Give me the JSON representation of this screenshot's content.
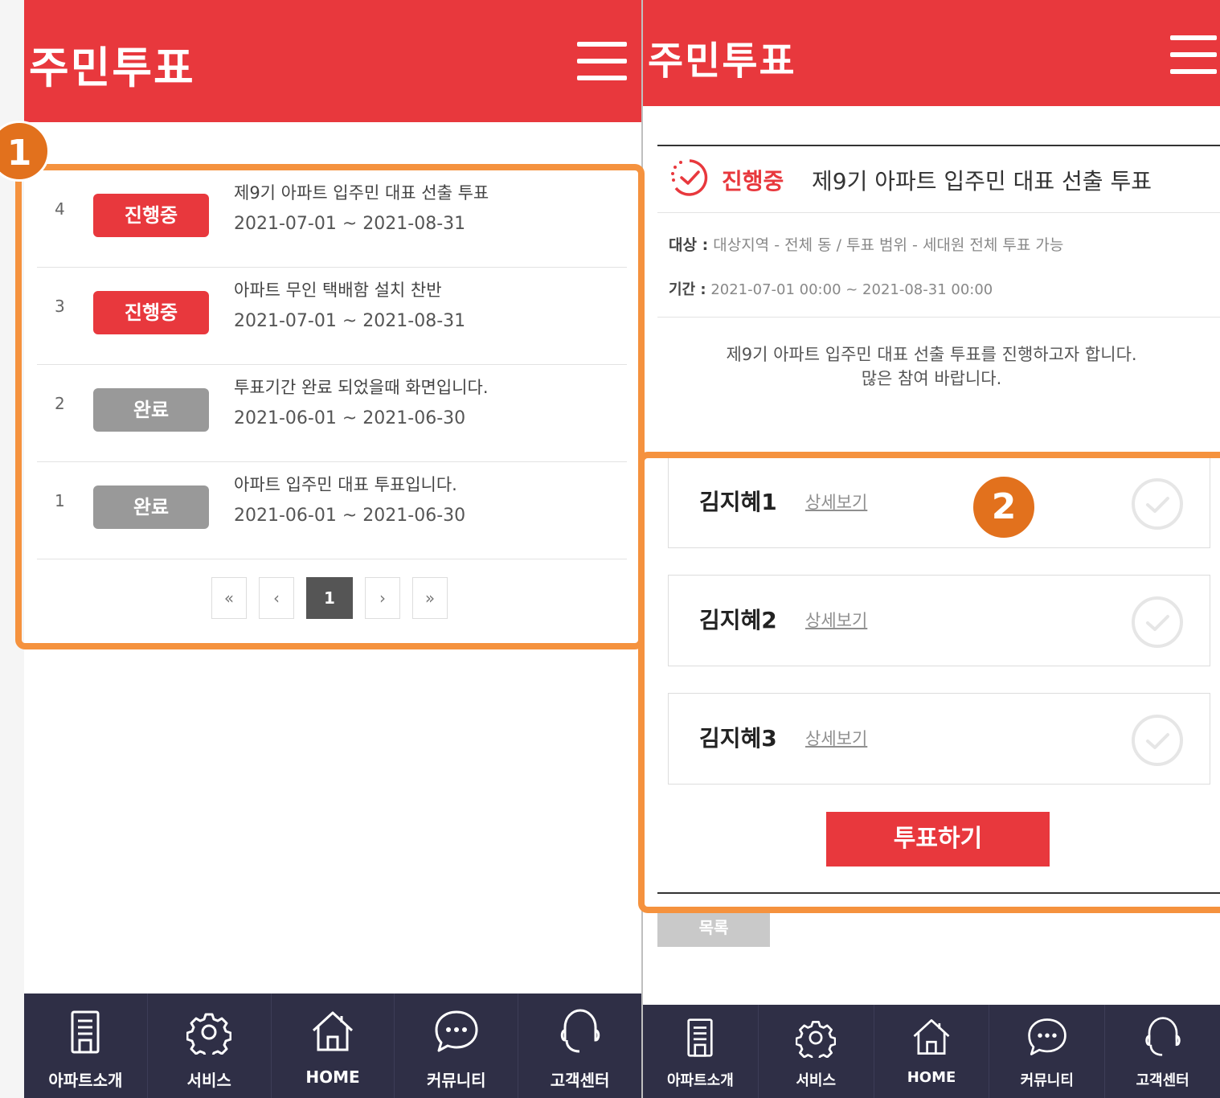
{
  "list_screen": {
    "header_title": "주민투표",
    "votes": [
      {
        "num": "4",
        "status": "진행중",
        "status_type": "active",
        "title": "제9기 아파트 입주민 대표 선출 투표",
        "period": "2021-07-01 ~ 2021-08-31"
      },
      {
        "num": "3",
        "status": "진행중",
        "status_type": "active",
        "title": "아파트 무인 택배함 설치 찬반",
        "period": "2021-07-01 ~ 2021-08-31"
      },
      {
        "num": "2",
        "status": "완료",
        "status_type": "done",
        "title": "투표기간 완료 되었을때 화면입니다.",
        "period": "2021-06-01 ~ 2021-06-30"
      },
      {
        "num": "1",
        "status": "완료",
        "status_type": "done",
        "title": "아파트 입주민 대표 투표입니다.",
        "period": "2021-06-01 ~ 2021-06-30"
      }
    ],
    "pagination": {
      "first": "«",
      "prev": "‹",
      "current": "1",
      "next": "›",
      "last": "»"
    }
  },
  "detail_screen": {
    "header_title": "주민투표",
    "status": "진행중",
    "title": "제9기 아파트 입주민 대표 선출 투표",
    "target_label": "대상 :",
    "target_value": "대상지역 - 전체 동 / 투표 범위 - 세대원 전체 투표 가능",
    "period_label": "기간 :",
    "period_value": "2021-07-01 00:00 ~ 2021-08-31 00:00",
    "description_line1": "제9기 아파트 입주민 대표 선출 투표를 진행하고자 합니다.",
    "description_line2": "많은 참여 바랍니다.",
    "candidates": [
      {
        "name": "김지혜1",
        "link": "상세보기"
      },
      {
        "name": "김지혜2",
        "link": "상세보기"
      },
      {
        "name": "김지혜3",
        "link": "상세보기"
      }
    ],
    "vote_button": "투표하기",
    "list_button": "목록"
  },
  "bottom_nav": [
    {
      "label": "아파트소개",
      "icon": "building-icon"
    },
    {
      "label": "서비스",
      "icon": "gear-icon"
    },
    {
      "label": "HOME",
      "icon": "home-icon"
    },
    {
      "label": "커뮤니티",
      "icon": "chat-icon"
    },
    {
      "label": "고객센터",
      "icon": "headset-icon"
    }
  ],
  "annotations": {
    "marker1": "1",
    "marker2": "2"
  },
  "colors": {
    "brand_red": "#e8383d",
    "nav_bg": "#2f2f46",
    "done_gray": "#999999",
    "annotation_orange": "#f5923e"
  }
}
